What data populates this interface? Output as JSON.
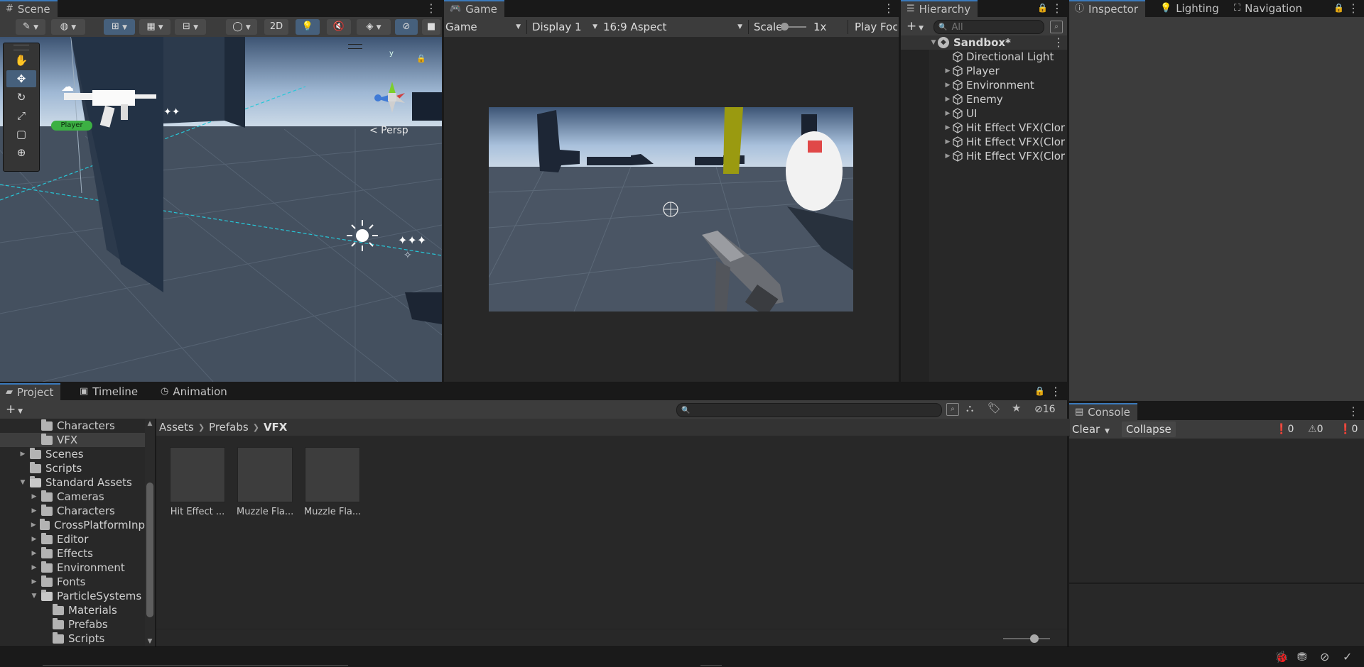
{
  "scene": {
    "tab": "Scene",
    "toolbar": {
      "mode_2d": "2D"
    },
    "player_label": "Player",
    "persp_label": "< Persp",
    "gizmo_axis": "y",
    "tools": [
      "hand-tool-icon",
      "move-tool-icon",
      "rotate-tool-icon",
      "scale-tool-icon",
      "rect-tool-icon",
      "transform-tool-icon"
    ]
  },
  "game": {
    "tab": "Game",
    "mode": "Game",
    "display": "Display 1",
    "aspect": "16:9 Aspect",
    "scale_label": "Scale",
    "scale_value": "1x",
    "play_focused": "Play Foc"
  },
  "hierarchy": {
    "tab": "Hierarchy",
    "search_placeholder": "All",
    "scene_name": "Sandbox*",
    "items": [
      {
        "label": "Directional Light",
        "expandable": false
      },
      {
        "label": "Player",
        "expandable": true
      },
      {
        "label": "Environment",
        "expandable": true
      },
      {
        "label": "Enemy",
        "expandable": true
      },
      {
        "label": "UI",
        "expandable": true
      },
      {
        "label": "Hit Effect VFX(Clor",
        "expandable": true
      },
      {
        "label": "Hit Effect VFX(Clor",
        "expandable": true
      },
      {
        "label": "Hit Effect VFX(Clor",
        "expandable": true
      }
    ]
  },
  "inspector_tabs": {
    "inspector": "Inspector",
    "lighting": "Lighting",
    "navigation": "Navigation"
  },
  "project": {
    "tabs": {
      "project": "Project",
      "timeline": "Timeline",
      "animation": "Animation"
    },
    "hidden_count": "16",
    "breadcrumb": [
      "Assets",
      "Prefabs",
      "VFX"
    ],
    "tree": [
      {
        "label": "Characters",
        "level": 2,
        "tri": "",
        "open": false,
        "selected": false
      },
      {
        "label": "VFX",
        "level": 2,
        "tri": "",
        "open": false,
        "selected": true
      },
      {
        "label": "Scenes",
        "level": 1,
        "tri": "▶",
        "open": false,
        "selected": false
      },
      {
        "label": "Scripts",
        "level": 1,
        "tri": "",
        "open": false,
        "selected": false
      },
      {
        "label": "Standard Assets",
        "level": 1,
        "tri": "▼",
        "open": true,
        "selected": false
      },
      {
        "label": "Cameras",
        "level": 2,
        "tri": "▶",
        "open": false,
        "selected": false
      },
      {
        "label": "Characters",
        "level": 2,
        "tri": "▶",
        "open": false,
        "selected": false
      },
      {
        "label": "CrossPlatformInp",
        "level": 2,
        "tri": "▶",
        "open": false,
        "selected": false
      },
      {
        "label": "Editor",
        "level": 2,
        "tri": "▶",
        "open": false,
        "selected": false
      },
      {
        "label": "Effects",
        "level": 2,
        "tri": "▶",
        "open": false,
        "selected": false
      },
      {
        "label": "Environment",
        "level": 2,
        "tri": "▶",
        "open": false,
        "selected": false
      },
      {
        "label": "Fonts",
        "level": 2,
        "tri": "▶",
        "open": false,
        "selected": false
      },
      {
        "label": "ParticleSystems",
        "level": 2,
        "tri": "▼",
        "open": true,
        "selected": false
      },
      {
        "label": "Materials",
        "level": 3,
        "tri": "",
        "open": false,
        "selected": false
      },
      {
        "label": "Prefabs",
        "level": 3,
        "tri": "",
        "open": false,
        "selected": false
      },
      {
        "label": "Scripts",
        "level": 3,
        "tri": "",
        "open": false,
        "selected": false
      }
    ],
    "assets": [
      "Hit Effect ...",
      "Muzzle Fla...",
      "Muzzle Fla..."
    ]
  },
  "console": {
    "tab": "Console",
    "clear": "Clear",
    "collapse": "Collapse",
    "info_count": "0",
    "warn_count": "0",
    "error_count": "0"
  },
  "colors": {
    "accent": "#3a79bb",
    "player_badge": "#3cb043",
    "enemy": "#e04848",
    "pillar": "#9a9a10"
  }
}
